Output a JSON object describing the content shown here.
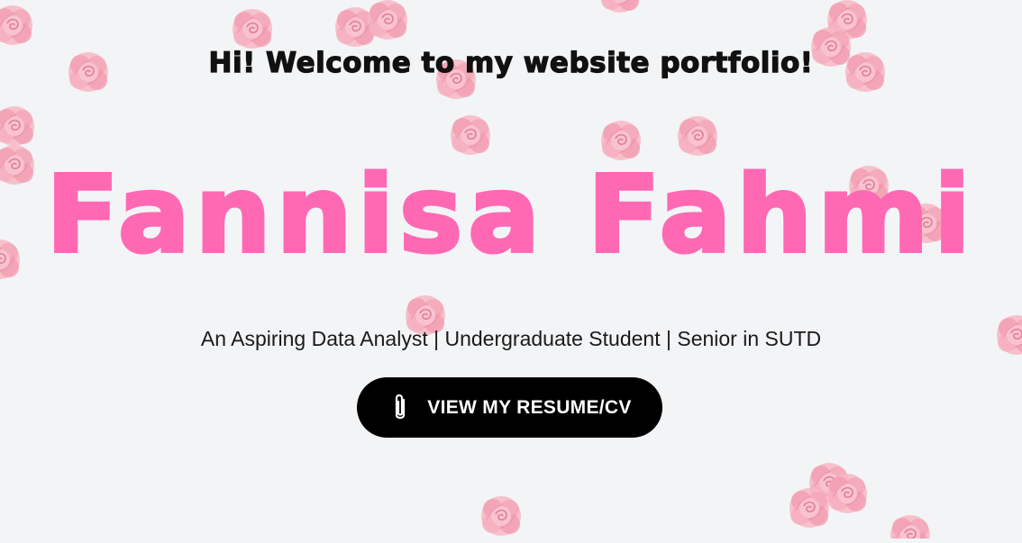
{
  "hero": {
    "welcome": "Hi! Welcome to my website portfolio!",
    "name": "Fannisa Fahmi",
    "tagline": "An Aspiring Data Analyst | Undergraduate Student | Senior in SUTD",
    "cta_label": "VIEW MY RESUME/CV",
    "cta_icon": "paperclip-icon"
  },
  "decoration": {
    "background": "pink-roses",
    "rose_color": "#f4a3b4"
  },
  "colors": {
    "background": "#f3f4f6",
    "name": "#ff69b4",
    "button_bg": "#000000",
    "button_text": "#ffffff",
    "text": "#111111"
  }
}
